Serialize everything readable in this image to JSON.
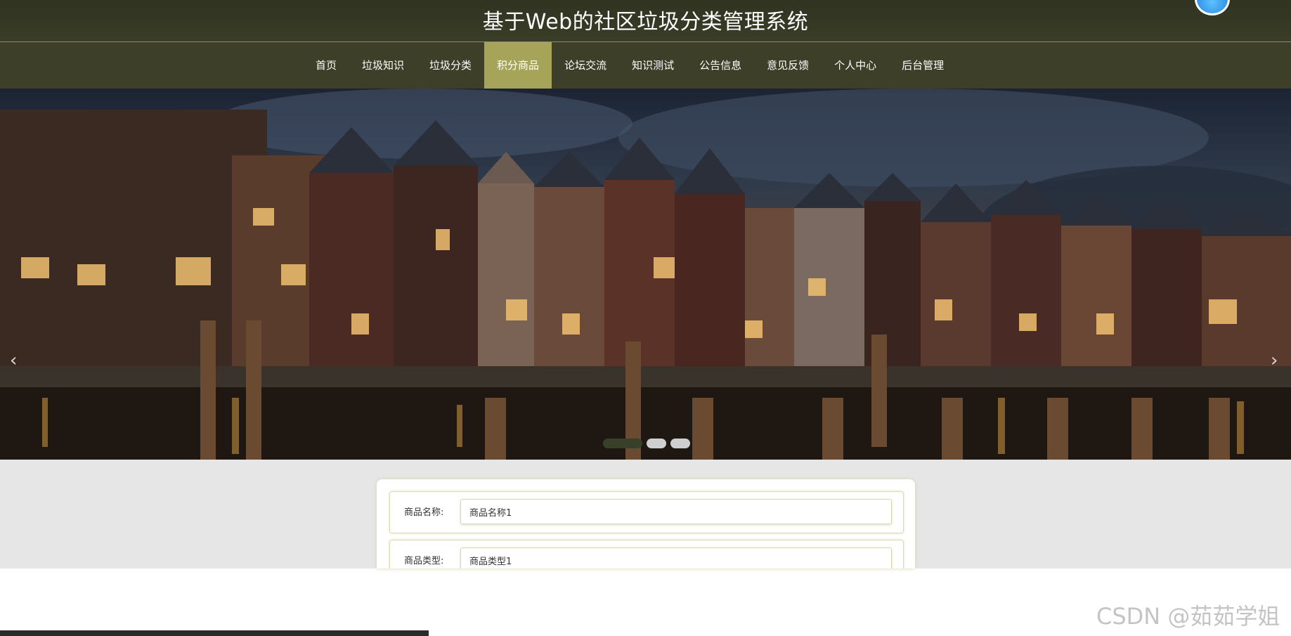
{
  "header": {
    "title": "基于Web的社区垃圾分类管理系统"
  },
  "nav": {
    "items": [
      {
        "label": "首页",
        "active": false
      },
      {
        "label": "垃圾知识",
        "active": false
      },
      {
        "label": "垃圾分类",
        "active": false
      },
      {
        "label": "积分商品",
        "active": true
      },
      {
        "label": "论坛交流",
        "active": false
      },
      {
        "label": "知识测试",
        "active": false
      },
      {
        "label": "公告信息",
        "active": false
      },
      {
        "label": "意见反馈",
        "active": false
      },
      {
        "label": "个人中心",
        "active": false
      },
      {
        "label": "后台管理",
        "active": false
      }
    ]
  },
  "banner": {
    "prev_arrow": "‹",
    "next_arrow": "›",
    "slides": 3,
    "active_slide": 1
  },
  "form": {
    "fields": [
      {
        "label": "商品名称:",
        "value": "商品名称1"
      },
      {
        "label": "商品类型:",
        "value": "商品类型1"
      }
    ]
  },
  "watermark": "CSDN @茹茹学姐",
  "colors": {
    "header_bg": "#2f3320",
    "nav_bg": "#3d3f29",
    "nav_active": "#a6a458",
    "content_bg": "#e6e6e6"
  }
}
